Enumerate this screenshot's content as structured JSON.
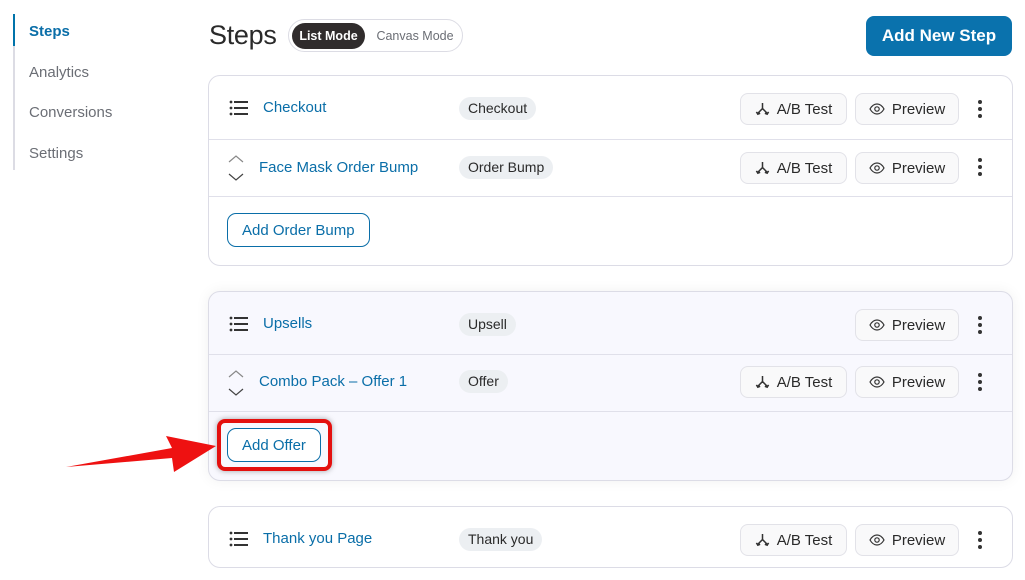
{
  "sidebar": {
    "items": [
      {
        "label": "Steps",
        "active": true
      },
      {
        "label": "Analytics",
        "active": false
      },
      {
        "label": "Conversions",
        "active": false
      },
      {
        "label": "Settings",
        "active": false
      }
    ]
  },
  "header": {
    "title": "Steps",
    "modes": {
      "list": "List Mode",
      "canvas": "Canvas Mode",
      "selected": "List Mode"
    },
    "add_step_label": "Add New Step"
  },
  "colors": {
    "accent": "#0a72ad",
    "link": "#0a6ea8",
    "annotation": "#e4100f",
    "toggle_active": "#302c2c"
  },
  "icons": {
    "drag": "list-icon",
    "sort": "chevron-up-down-icon",
    "ab": "split-arrows-icon",
    "preview": "eye-icon",
    "more": "kebab-icon"
  },
  "groups": [
    {
      "main": {
        "name": "Checkout",
        "badge": "Checkout",
        "ab_label": "A/B Test",
        "preview_label": "Preview"
      },
      "sub": {
        "name": "Face Mask Order Bump",
        "badge": "Order Bump",
        "ab_label": "A/B Test",
        "preview_label": "Preview"
      },
      "add_label": "Add Order Bump"
    },
    {
      "main": {
        "name": "Upsells",
        "badge": "Upsell",
        "preview_label": "Preview"
      },
      "sub": {
        "name": "Combo Pack – Offer 1",
        "badge": "Offer",
        "ab_label": "A/B Test",
        "preview_label": "Preview"
      },
      "add_label": "Add Offer"
    },
    {
      "main": {
        "name": "Thank you Page",
        "badge": "Thank you",
        "ab_label": "A/B Test",
        "preview_label": "Preview"
      }
    }
  ]
}
